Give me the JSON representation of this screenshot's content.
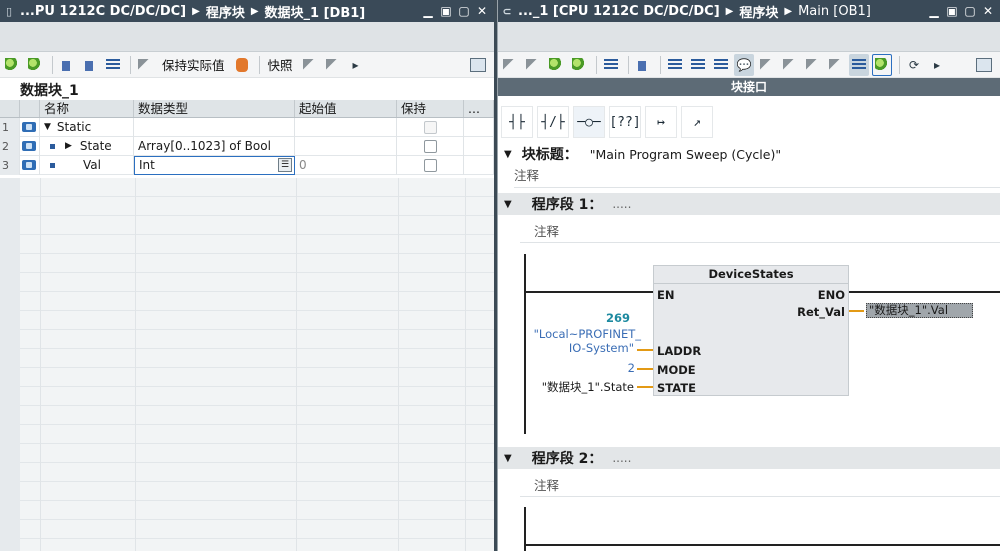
{
  "left": {
    "title": {
      "device": "...PU 1212C DC/DC/DC]",
      "crumb1": "程序块",
      "crumb2": "数据块_1 [DB1]"
    },
    "toolbar": {
      "keep_actual": "保持实际值",
      "snapshot": "快照"
    },
    "db_name": "数据块_1",
    "columns": {
      "name": "名称",
      "type": "数据类型",
      "start": "起始值",
      "retain": "保持",
      "more": "..."
    },
    "rows": [
      {
        "num": "1",
        "name": "Static",
        "type": "",
        "start": ""
      },
      {
        "num": "2",
        "name": "State",
        "type": "Array[0..1023] of Bool",
        "start": ""
      },
      {
        "num": "3",
        "name": "Val",
        "type": "Int",
        "start": "0"
      }
    ]
  },
  "right": {
    "title": {
      "device": "..._1 [CPU 1212C DC/DC/DC]",
      "crumb1": "程序块",
      "crumb2": "Main [OB1]"
    },
    "interface_bar": "块接口",
    "lad_tools": [
      "┤├",
      "┤/├",
      "─○─",
      "[??]",
      "↦",
      "↗"
    ],
    "block_title_label": "块标题：",
    "block_title_value": "\"Main Program Sweep (Cycle)\"",
    "comment": "注释",
    "network1": {
      "label": "程序段 1：",
      "dots": "....."
    },
    "network2": {
      "label": "程序段 2：",
      "dots": "....."
    },
    "fb": {
      "name": "DeviceStates",
      "en": "EN",
      "eno": "ENO",
      "ret_val_pin": "Ret_Val",
      "laddr_pin": "LADDR",
      "mode_pin": "MODE",
      "state_pin": "STATE",
      "laddr_value": "269",
      "laddr_sym1": "\"Local~PROFINET_",
      "laddr_sym2": "IO-System\"",
      "mode_value": "2",
      "state_value": "\"数据块_1\".State",
      "ret_val_value": "\"数据块_1\".Val"
    }
  }
}
